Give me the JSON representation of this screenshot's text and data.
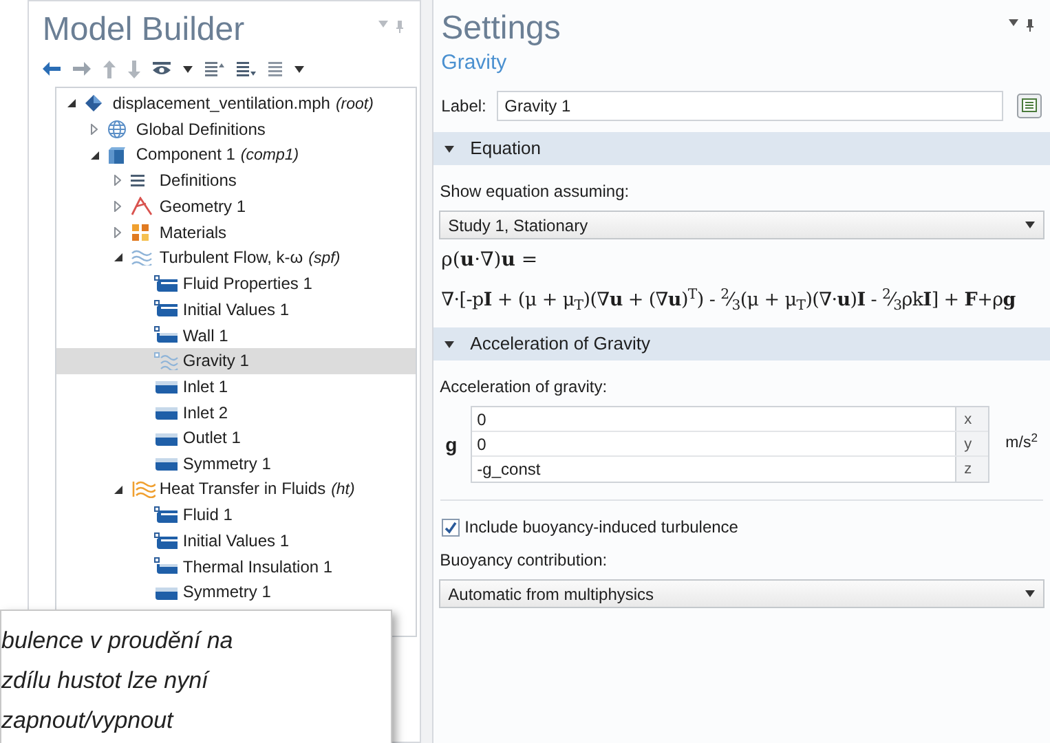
{
  "model_builder": {
    "title": "Model Builder",
    "tree": [
      {
        "label": "displacement_ventilation.mph",
        "tag": "(root)",
        "kind": "root",
        "expanded": true,
        "selected": false,
        "children": [
          {
            "label": "Global Definitions",
            "kind": "globe",
            "expanded": false,
            "selected": false
          },
          {
            "label": "Component 1",
            "tag": "(comp1)",
            "kind": "component",
            "expanded": true,
            "selected": false,
            "children": [
              {
                "label": "Definitions",
                "kind": "list",
                "expanded": false,
                "selected": false
              },
              {
                "label": "Geometry 1",
                "kind": "geometry",
                "expanded": false,
                "selected": false
              },
              {
                "label": "Materials",
                "kind": "materials",
                "expanded": false,
                "selected": false
              },
              {
                "label": "Turbulent Flow, k-ω",
                "tag": "(spf)",
                "kind": "flow",
                "expanded": true,
                "selected": false,
                "children": [
                  {
                    "label": "Fluid Properties 1",
                    "kind": "domain",
                    "selected": false
                  },
                  {
                    "label": "Initial Values 1",
                    "kind": "domain",
                    "selected": false
                  },
                  {
                    "label": "Wall 1",
                    "kind": "boundary-point",
                    "selected": false
                  },
                  {
                    "label": "Gravity 1",
                    "kind": "gravity",
                    "selected": true
                  },
                  {
                    "label": "Inlet 1",
                    "kind": "boundary",
                    "selected": false
                  },
                  {
                    "label": "Inlet 2",
                    "kind": "boundary",
                    "selected": false
                  },
                  {
                    "label": "Outlet 1",
                    "kind": "boundary",
                    "selected": false
                  },
                  {
                    "label": "Symmetry 1",
                    "kind": "boundary",
                    "selected": false
                  }
                ]
              },
              {
                "label": "Heat Transfer in Fluids",
                "tag": "(ht)",
                "kind": "heat",
                "expanded": true,
                "selected": false,
                "children": [
                  {
                    "label": "Fluid 1",
                    "kind": "domain",
                    "selected": false
                  },
                  {
                    "label": "Initial Values 1",
                    "kind": "domain",
                    "selected": false
                  },
                  {
                    "label": "Thermal Insulation 1",
                    "kind": "boundary-point",
                    "selected": false
                  },
                  {
                    "label": "Symmetry 1",
                    "kind": "boundary",
                    "selected": false
                  }
                ]
              }
            ]
          }
        ]
      }
    ]
  },
  "settings": {
    "title": "Settings",
    "subtitle": "Gravity",
    "label_caption": "Label:",
    "label_value": "Gravity 1",
    "sections": [
      {
        "title": "Equation",
        "expanded": true,
        "kind": "equation",
        "caption": "Show equation assuming:",
        "dropdown": "Study 1, Stationary",
        "equations": [
          "ρ(**u**·∇)**u** =",
          "∇·[-p**I** + (μ + μ$_{T}$)(∇**u** + (∇**u**)$^{T}$) - $^{2}$⁄$_{3}$(μ + μ$_{T}$)(∇·**u**)**I** - $^{2}$⁄$_{3}$ρk**I**] + **F**+ρ**g**"
        ]
      },
      {
        "title": "Acceleration of Gravity",
        "expanded": true,
        "kind": "vector",
        "caption": "Acceleration of gravity:",
        "symbol": "g",
        "unit": "m/s$^{2}$",
        "rows": [
          {
            "value": "0",
            "component": "x"
          },
          {
            "value": "0",
            "component": "y"
          },
          {
            "value": "-g_const",
            "component": "z"
          }
        ],
        "checkbox": {
          "label": "Include buoyancy-induced turbulence",
          "checked": true
        },
        "caption2": "Buoyancy contribution:",
        "dropdown": "Automatic from multiphysics"
      }
    ]
  },
  "callout": {
    "lines": [
      "bulence v proudění na",
      "zdílu hustot lze nyní",
      "zapnout/vypnout"
    ]
  }
}
